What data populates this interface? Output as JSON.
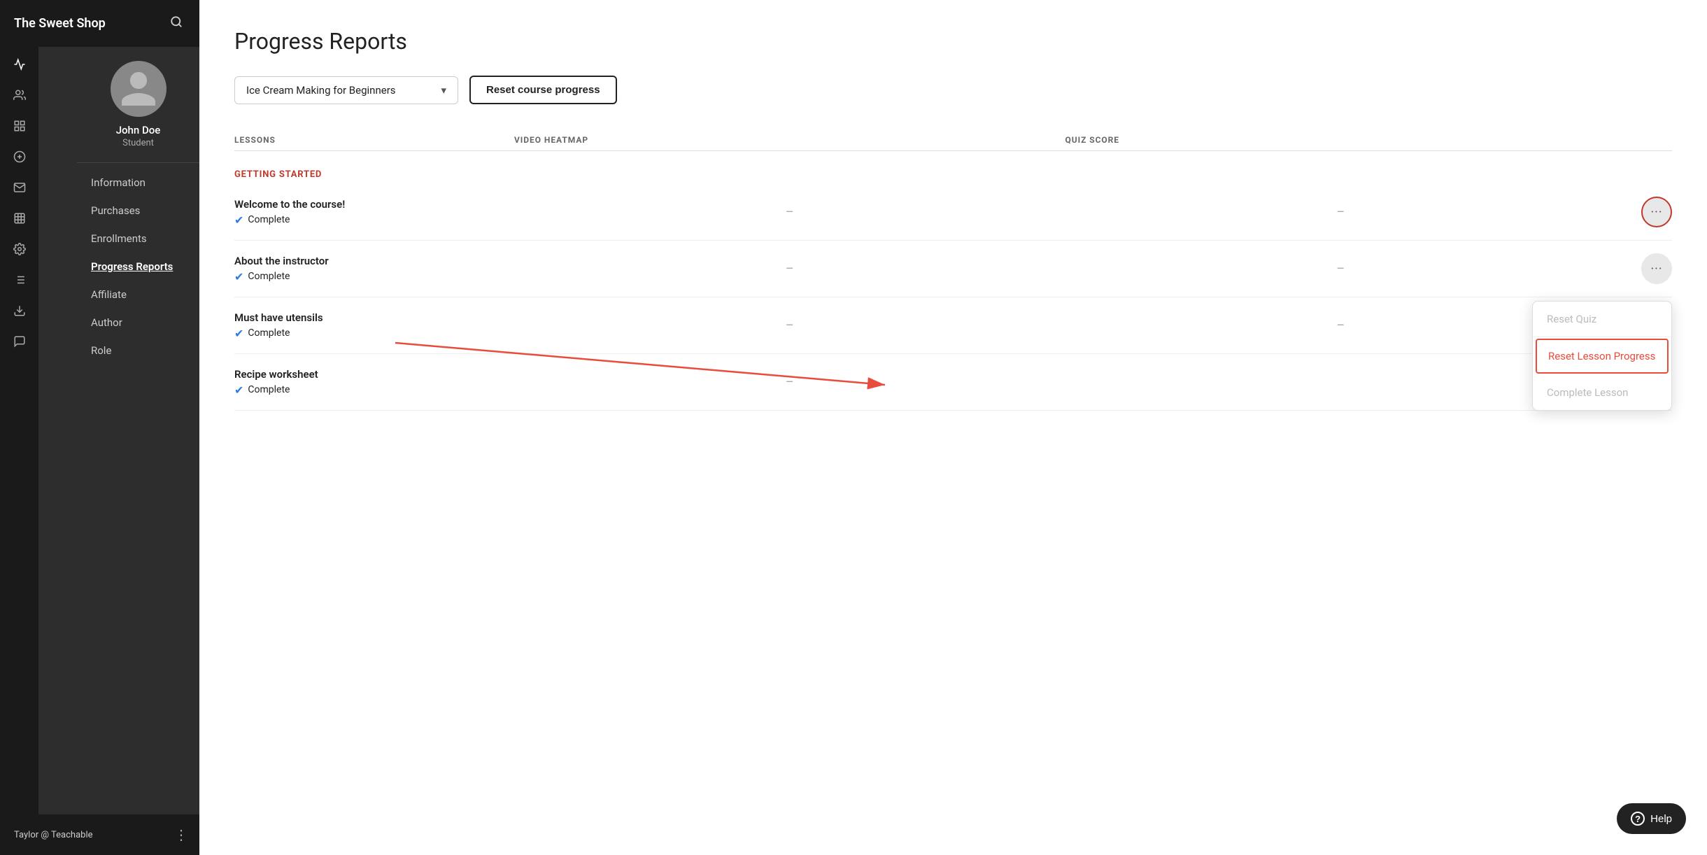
{
  "app": {
    "title": "The Sweet Shop",
    "search_placeholder": "Search"
  },
  "sidebar": {
    "profile": {
      "name": "John Doe",
      "role": "Student"
    },
    "nav_items": [
      {
        "id": "information",
        "label": "Information",
        "active": false
      },
      {
        "id": "purchases",
        "label": "Purchases",
        "active": false
      },
      {
        "id": "enrollments",
        "label": "Enrollments",
        "active": false
      },
      {
        "id": "progress-reports",
        "label": "Progress Reports",
        "active": true
      },
      {
        "id": "affiliate",
        "label": "Affiliate",
        "active": false
      },
      {
        "id": "author",
        "label": "Author",
        "active": false
      },
      {
        "id": "role",
        "label": "Role",
        "active": false
      }
    ],
    "footer_user": "Taylor @ Teachable"
  },
  "main": {
    "page_title": "Progress Reports",
    "course_dropdown": {
      "selected": "Ice Cream Making for Beginners",
      "chevron": "▾"
    },
    "reset_course_btn": "Reset course progress",
    "table": {
      "columns": [
        "LESSONS",
        "VIDEO HEATMAP",
        "QUIZ SCORE",
        ""
      ],
      "section_label": "GETTING STARTED",
      "lessons": [
        {
          "name": "Welcome to the course!",
          "status": "Complete",
          "video_heatmap": "–",
          "quiz_score": "–"
        },
        {
          "name": "About the instructor",
          "status": "Complete",
          "video_heatmap": "–",
          "quiz_score": "–"
        },
        {
          "name": "Must have utensils",
          "status": "Complete",
          "video_heatmap": "–",
          "quiz_score": "–"
        },
        {
          "name": "Recipe worksheet",
          "status": "Complete",
          "video_heatmap": "–",
          "quiz_score": "–"
        }
      ]
    },
    "dropdown_menu": {
      "items": [
        {
          "id": "reset-quiz",
          "label": "Reset Quiz",
          "disabled": true,
          "active": false
        },
        {
          "id": "reset-lesson-progress",
          "label": "Reset Lesson Progress",
          "disabled": false,
          "active": true
        },
        {
          "id": "complete-lesson",
          "label": "Complete Lesson",
          "disabled": true,
          "active": false
        }
      ]
    },
    "help_btn": "Help"
  }
}
